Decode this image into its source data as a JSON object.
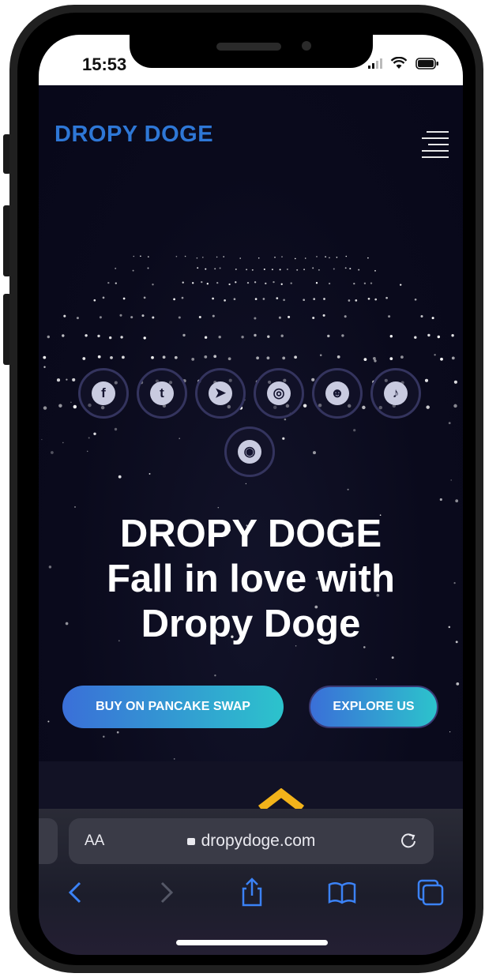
{
  "status_bar": {
    "time": "15:53"
  },
  "site": {
    "brand": "DROPY DOGE",
    "brand_color": "#2e77d6",
    "menu_icon": "hamburger-menu-icon",
    "socials": [
      {
        "name": "facebook-icon",
        "glyph": "f"
      },
      {
        "name": "twitter-icon",
        "glyph": "t"
      },
      {
        "name": "telegram-icon",
        "glyph": "➤"
      },
      {
        "name": "instagram-icon",
        "glyph": "◎"
      },
      {
        "name": "reddit-icon",
        "glyph": "☻"
      },
      {
        "name": "tiktok-icon",
        "glyph": "♪"
      },
      {
        "name": "discord-icon",
        "glyph": "◉"
      }
    ],
    "hero_line1": "DROPY DOGE",
    "hero_line2": "Fall in love with",
    "hero_line3": "Dropy Doge",
    "buy_button": "BUY ON PANCAKE SWAP",
    "explore_button": "EXPLORE US",
    "accent_gradient": [
      "#3a6fd8",
      "#2cc3cc"
    ],
    "chevron_color": "#f2b31a"
  },
  "browser": {
    "text_size_label": "AA",
    "url": "dropydoge.com",
    "toolbar": [
      {
        "name": "back-icon",
        "glyph": "‹"
      },
      {
        "name": "forward-icon",
        "glyph": "›"
      },
      {
        "name": "share-icon",
        "glyph": "⇪"
      },
      {
        "name": "bookmarks-icon",
        "glyph": "📖"
      },
      {
        "name": "tabs-icon",
        "glyph": "⧉"
      }
    ]
  }
}
